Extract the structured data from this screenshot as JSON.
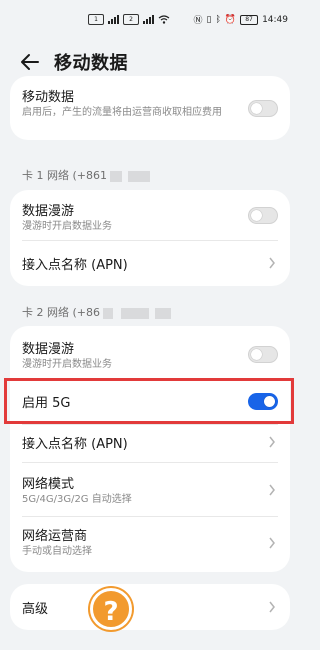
{
  "status_bar": {
    "sim1": "1",
    "sim2": "2",
    "battery": "87",
    "time": "14:49"
  },
  "header": {
    "title": "移动数据"
  },
  "top_card": {
    "title": "移动数据",
    "subtitle": "启用后，产生的流量将由运营商收取相应费用",
    "toggle_on": false
  },
  "sim1": {
    "section_label": "卡 1 网络 (+861",
    "roaming_title": "数据漫游",
    "roaming_subtitle": "漫游时开启数据业务",
    "roaming_on": false,
    "apn_title": "接入点名称 (APN)"
  },
  "sim2": {
    "section_label": "卡 2 网络 (+86",
    "roaming_title": "数据漫游",
    "roaming_subtitle": "漫游时开启数据业务",
    "roaming_on": false,
    "enable5g_title": "启用 5G",
    "enable5g_on": true,
    "apn_title": "接入点名称 (APN)",
    "network_mode_title": "网络模式",
    "network_mode_subtitle": "5G/4G/3G/2G 自动选择",
    "operator_title": "网络运营商",
    "operator_subtitle": "手动或自动选择"
  },
  "advanced": {
    "title": "高级"
  },
  "help_badge": "?",
  "colors": {
    "accent": "#1864e8",
    "highlight": "#e23a3a",
    "help": "#f29a2e"
  }
}
